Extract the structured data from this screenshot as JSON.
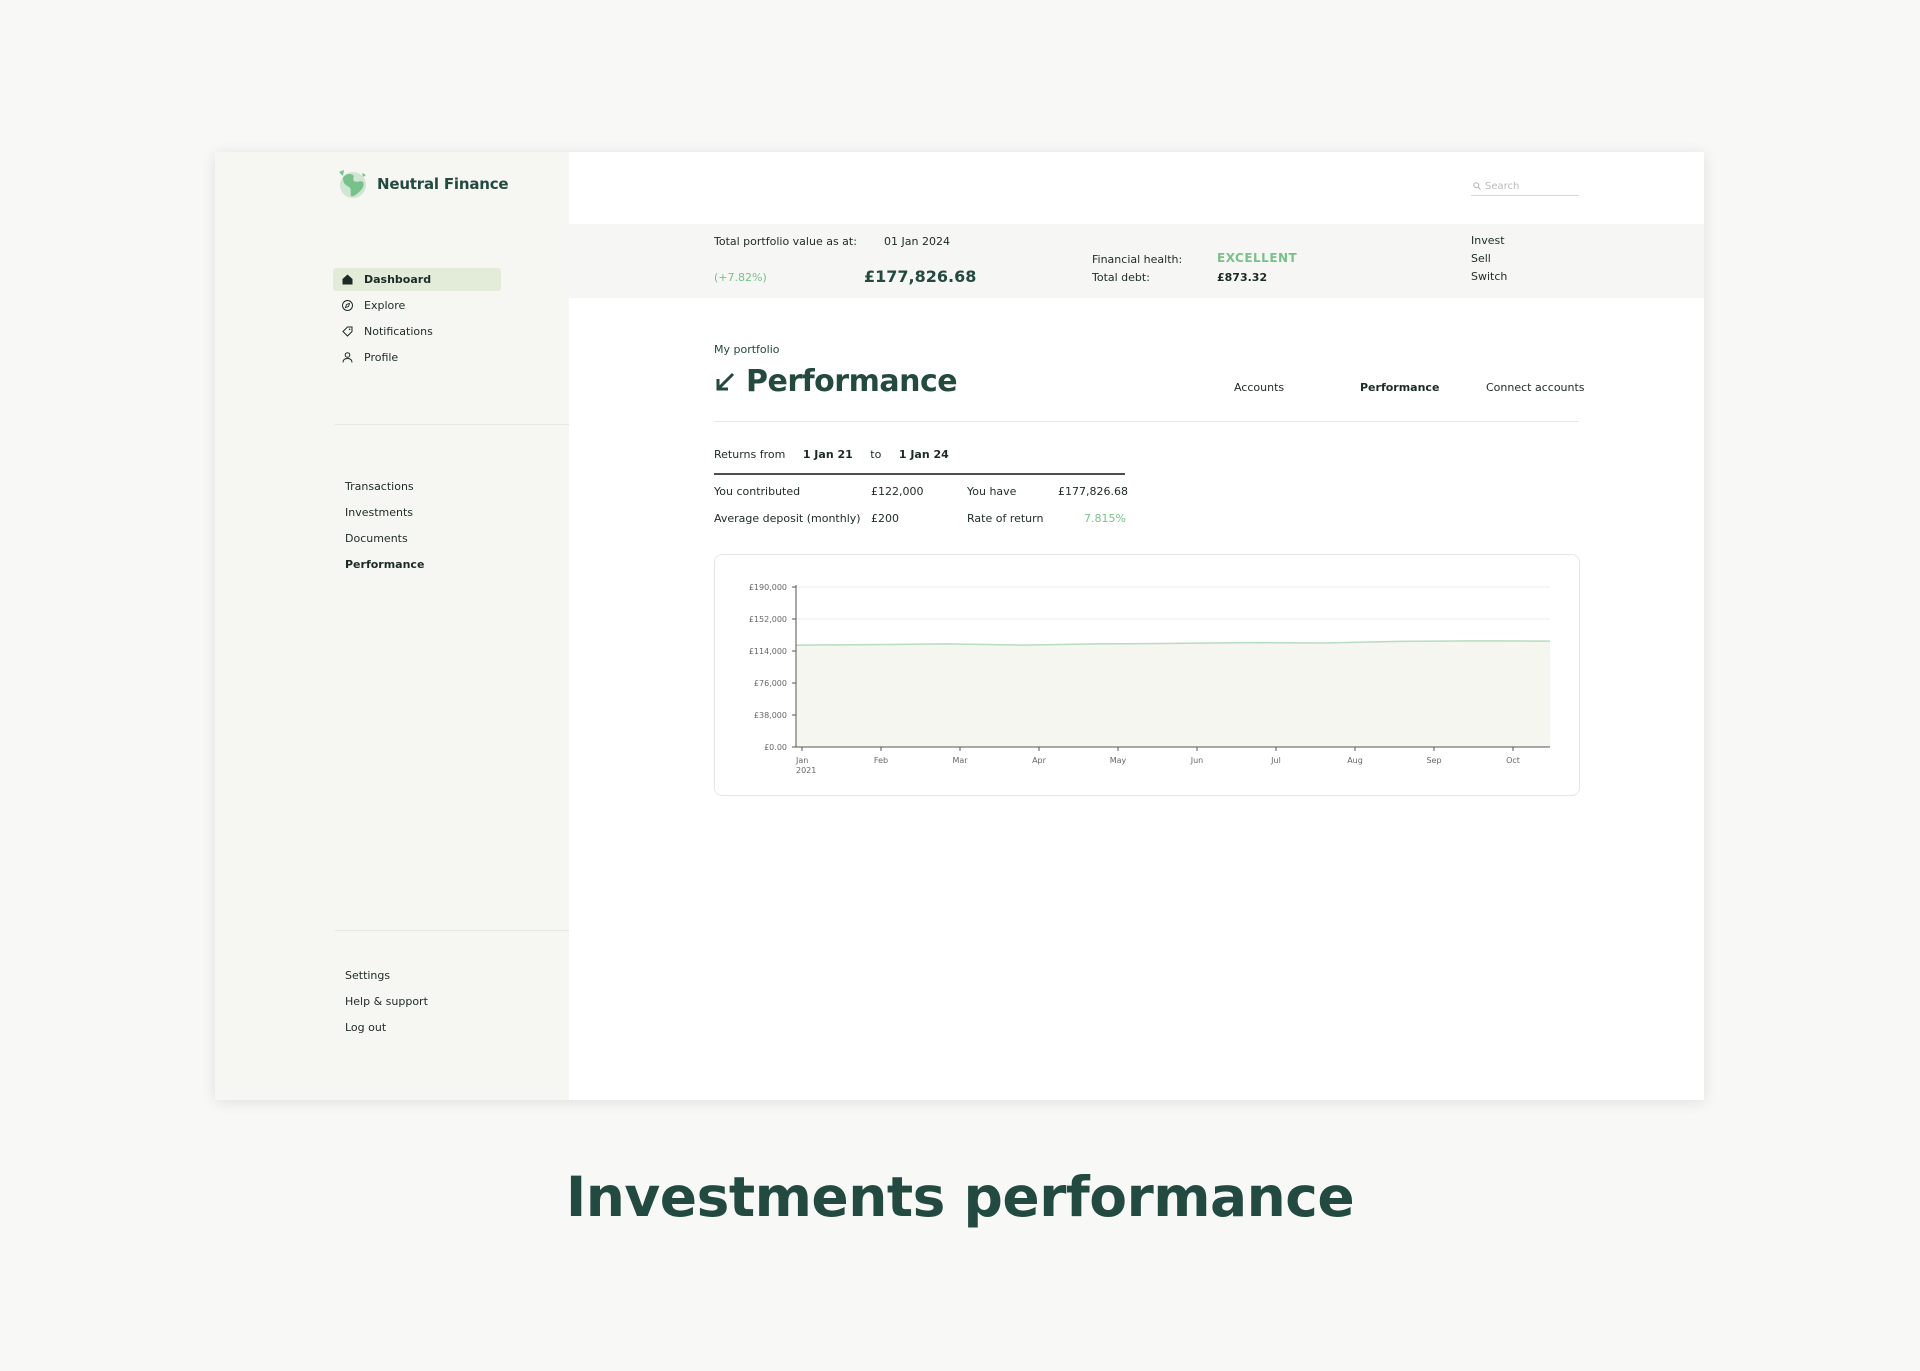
{
  "app": {
    "name": "Neutral Finance"
  },
  "sidebar": {
    "nav": [
      {
        "label": "Dashboard",
        "icon": "home-icon",
        "active": true
      },
      {
        "label": "Explore",
        "icon": "compass-icon",
        "active": false
      },
      {
        "label": "Notifications",
        "icon": "tag-icon",
        "active": false
      },
      {
        "label": "Profile",
        "icon": "user-icon",
        "active": false
      }
    ],
    "sections": [
      "Transactions",
      "Investments",
      "Documents",
      "Performance"
    ],
    "footer": [
      "Settings",
      "Help & support",
      "Log out"
    ]
  },
  "search": {
    "placeholder": "Search"
  },
  "summary": {
    "label": "Total portfolio value as at:",
    "date": "01 Jan 2024",
    "change": "(+7.82%)",
    "value": "£177,826.68",
    "health_label": "Financial health:",
    "health_value": "EXCELLENT",
    "debt_label": "Total debt:",
    "debt_value": "£873.32",
    "actions": [
      "Invest",
      "Sell",
      "Switch"
    ]
  },
  "page": {
    "breadcrumb": "My portfolio",
    "title": "Performance",
    "tabs": [
      {
        "label": "Accounts",
        "active": false
      },
      {
        "label": "Performance",
        "active": true
      },
      {
        "label": "Connect accounts",
        "active": false
      }
    ]
  },
  "returns": {
    "from_label": "Returns from",
    "from": "1 Jan 21",
    "to_label": "to",
    "to": "1 Jan 24"
  },
  "stats": {
    "contributed_label": "You contributed",
    "contributed": "£122,000",
    "deposit_label": "Average deposit (monthly)",
    "deposit": "£200",
    "have_label": "You have",
    "have": "£177,826.68",
    "rate_label": "Rate of return",
    "rate": "7.815%"
  },
  "chart_data": {
    "type": "area",
    "categories": [
      "Jan\n2021",
      "Feb",
      "Mar",
      "Apr",
      "May",
      "Jun",
      "Jul",
      "Aug",
      "Sep",
      "Oct"
    ],
    "series": [
      {
        "values": [
          121000,
          121500,
          122500,
          121000,
          122500,
          123000,
          124000,
          123500,
          125500,
          126000,
          125800
        ]
      }
    ],
    "ylim": [
      0,
      190000
    ],
    "yticks": [
      "£0.00",
      "£38,000",
      "£76,000",
      "£114,000",
      "£152,000",
      "£190,000"
    ],
    "grid": true
  },
  "colors": {
    "brand": "#244a40",
    "accent": "#78c18a",
    "sidebar": "#f6f7f2",
    "active_nav": "#e3ebd9"
  },
  "caption": "Investments performance"
}
